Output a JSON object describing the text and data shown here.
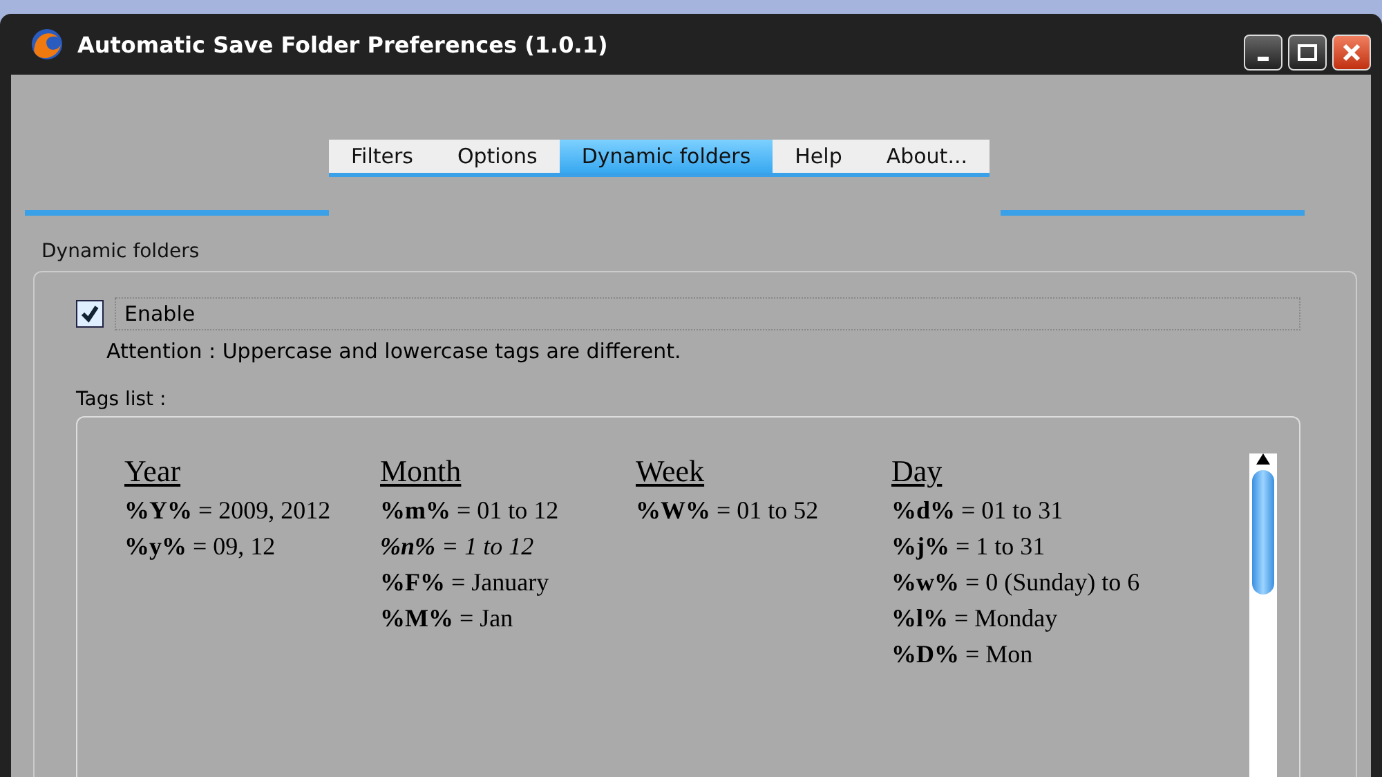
{
  "window": {
    "title": "Automatic Save Folder Preferences (1.0.1)"
  },
  "tabs": [
    {
      "label": "Filters",
      "selected": false
    },
    {
      "label": "Options",
      "selected": false
    },
    {
      "label": "Dynamic folders",
      "selected": true
    },
    {
      "label": "Help",
      "selected": false
    },
    {
      "label": "About...",
      "selected": false
    }
  ],
  "section": {
    "title": "Dynamic folders"
  },
  "enable": {
    "label": "Enable",
    "checked": true
  },
  "attention": "Attention : Uppercase and lowercase tags are different.",
  "tags_list": {
    "label": "Tags list :",
    "groups": [
      {
        "heading": "Year",
        "tags": [
          {
            "code": "%Y%",
            "desc": "= 2009, 2012",
            "italic": false
          },
          {
            "code": "%y%",
            "desc": "= 09, 12",
            "italic": false
          }
        ]
      },
      {
        "heading": "Month",
        "tags": [
          {
            "code": "%m%",
            "desc": "= 01 to 12",
            "italic": false
          },
          {
            "code": "%n%",
            "desc": "= 1 to 12",
            "italic": true
          },
          {
            "code": "%F%",
            "desc": "= January",
            "italic": false
          },
          {
            "code": "%M%",
            "desc": "= Jan",
            "italic": false
          }
        ]
      },
      {
        "heading": "Week",
        "tags": [
          {
            "code": "%W%",
            "desc": "= 01 to 52",
            "italic": false
          }
        ]
      },
      {
        "heading": "Day",
        "tags": [
          {
            "code": "%d%",
            "desc": "= 01 to 31",
            "italic": false
          },
          {
            "code": "%j%",
            "desc": "= 1 to 31",
            "italic": false
          },
          {
            "code": "%w%",
            "desc": "= 0 (Sunday) to 6",
            "italic": false
          },
          {
            "code": "%l%",
            "desc": "= Monday",
            "italic": false
          },
          {
            "code": "%D%",
            "desc": "= Mon",
            "italic": false
          }
        ]
      }
    ]
  }
}
